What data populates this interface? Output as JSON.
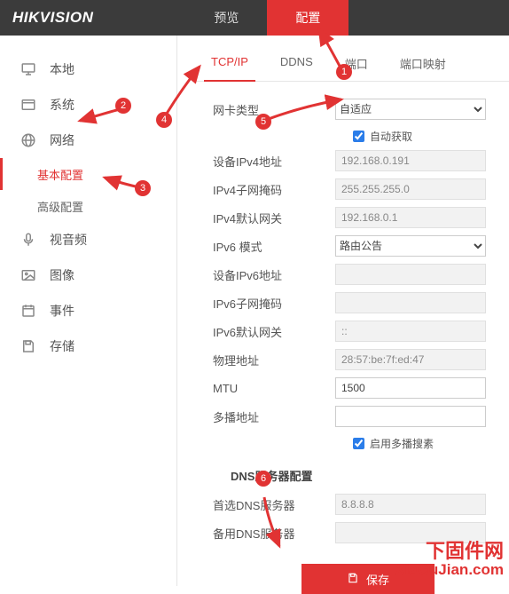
{
  "logo": "HIKVISION",
  "nav": {
    "preview": "预览",
    "config": "配置"
  },
  "sidebar": {
    "items": [
      {
        "label": "本地"
      },
      {
        "label": "系统"
      },
      {
        "label": "网络"
      },
      {
        "label": "视音频"
      },
      {
        "label": "图像"
      },
      {
        "label": "事件"
      },
      {
        "label": "存储"
      }
    ],
    "sub": {
      "basic": "基本配置",
      "advanced": "高级配置"
    }
  },
  "subtabs": {
    "tcpip": "TCP/IP",
    "ddns": "DDNS",
    "port": "端口",
    "portmap": "端口映射"
  },
  "form": {
    "nic_type_label": "网卡类型",
    "nic_type_value": "自适应",
    "auto_obtain": "自动获取",
    "ipv4_addr_label": "设备IPv4地址",
    "ipv4_addr_value": "192.168.0.191",
    "ipv4_mask_label": "IPv4子网掩码",
    "ipv4_mask_value": "255.255.255.0",
    "ipv4_gw_label": "IPv4默认网关",
    "ipv4_gw_value": "192.168.0.1",
    "ipv6_mode_label": "IPv6 模式",
    "ipv6_mode_value": "路由公告",
    "ipv6_addr_label": "设备IPv6地址",
    "ipv6_addr_value": "",
    "ipv6_mask_label": "IPv6子网掩码",
    "ipv6_mask_value": "",
    "ipv6_gw_label": "IPv6默认网关",
    "ipv6_gw_value": "::",
    "mac_label": "物理地址",
    "mac_value": "28:57:be:7f:ed:47",
    "mtu_label": "MTU",
    "mtu_value": "1500",
    "multicast_label": "多播地址",
    "multicast_value": "",
    "multicast_search": "启用多播搜素",
    "dns_section": "DNS服务器配置",
    "dns1_label": "首选DNS服务器",
    "dns1_value": "8.8.8.8",
    "dns2_label": "备用DNS服务器",
    "dns2_value": "",
    "save": "保存"
  },
  "annotations": {
    "1": "1",
    "2": "2",
    "3": "3",
    "4": "4",
    "5": "5",
    "6": "6"
  },
  "watermark": {
    "l1": "下固件网",
    "l2": "XiaGuJian.com"
  }
}
